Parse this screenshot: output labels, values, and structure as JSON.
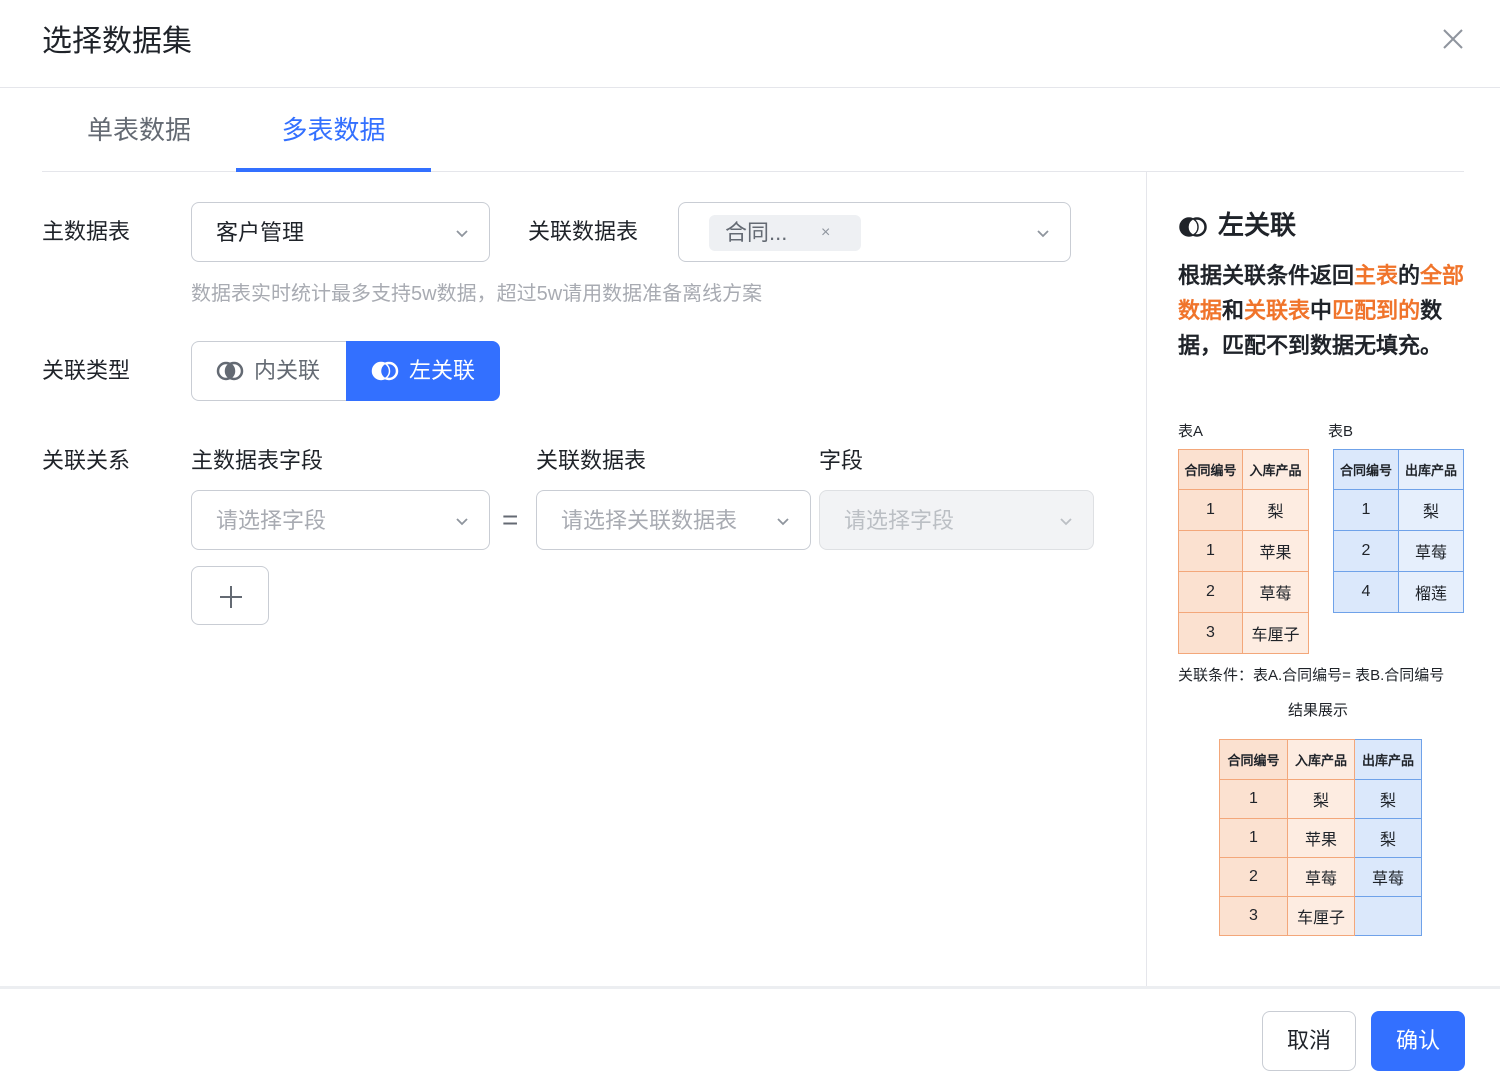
{
  "dialog": {
    "title": "选择数据集",
    "close_icon": "close-icon"
  },
  "tabs": [
    {
      "label": "单表数据",
      "active": false
    },
    {
      "label": "多表数据",
      "active": true
    }
  ],
  "form": {
    "main_table_label": "主数据表",
    "main_table_value": "客户管理",
    "related_table_label": "关联数据表",
    "related_table_tag": "合同...",
    "tag_close": "×",
    "hint": "数据表实时统计最多支持5w数据，超过5w请用数据准备离线方案",
    "join_type_label": "关联类型",
    "join_types": [
      {
        "label": "内关联",
        "selected": false
      },
      {
        "label": "左关联",
        "selected": true
      }
    ],
    "relation_label": "关联关系",
    "col_main_field": "主数据表字段",
    "col_related_table": "关联数据表",
    "col_field": "字段",
    "main_field_placeholder": "请选择字段",
    "equals": "=",
    "related_table_placeholder": "请选择关联数据表",
    "field_placeholder": "请选择字段"
  },
  "footer": {
    "cancel_label": "取消",
    "ok_label": "确认"
  },
  "help": {
    "title": "左关联",
    "desc_parts": [
      {
        "text": "根据关联条件返回",
        "hl": false
      },
      {
        "text": "主表",
        "hl": true
      },
      {
        "text": "的",
        "hl": false
      },
      {
        "text": "全部数据",
        "hl": true
      },
      {
        "text": "和",
        "hl": false
      },
      {
        "text": "关联表",
        "hl": true
      },
      {
        "text": "中",
        "hl": false
      },
      {
        "text": "匹配到的",
        "hl": true
      },
      {
        "text": "数据，匹配不到数据无填充。",
        "hl": false
      }
    ],
    "table_a_caption": "表A",
    "table_b_caption": "表B",
    "table_a": {
      "headers": [
        "合同编号",
        "入库产品"
      ],
      "rows": [
        [
          "1",
          "梨"
        ],
        [
          "1",
          "苹果"
        ],
        [
          "2",
          "草莓"
        ],
        [
          "3",
          "车厘子"
        ]
      ]
    },
    "table_b": {
      "headers": [
        "合同编号",
        "出库产品"
      ],
      "rows": [
        [
          "1",
          "梨"
        ],
        [
          "2",
          "草莓"
        ],
        [
          "4",
          "榴莲"
        ]
      ]
    },
    "condition": "关联条件：表A.合同编号= 表B.合同编号",
    "result_caption": "结果展示",
    "result": {
      "headers": [
        "合同编号",
        "入库产品",
        "出库产品"
      ],
      "rows": [
        [
          "1",
          "梨",
          "梨"
        ],
        [
          "1",
          "苹果",
          "梨"
        ],
        [
          "2",
          "草莓",
          "草莓"
        ],
        [
          "3",
          "车厘子",
          ""
        ]
      ]
    },
    "colors": {
      "orange": "#f0742b",
      "blue": "#3370ff"
    }
  }
}
